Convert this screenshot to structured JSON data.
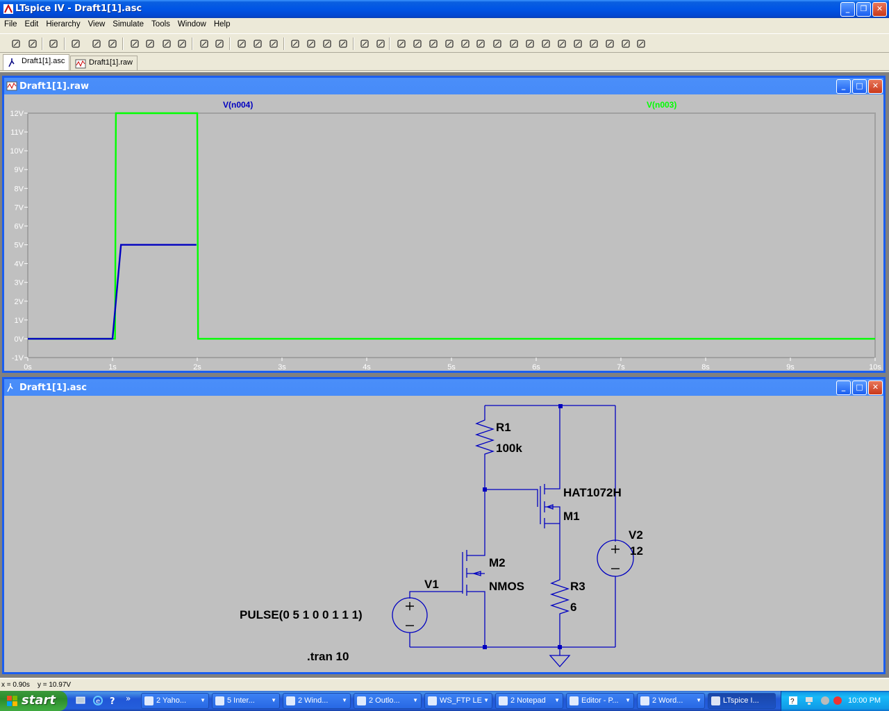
{
  "app": {
    "title": "LTspice IV - Draft1[1].asc"
  },
  "menu": [
    "File",
    "Edit",
    "Hierarchy",
    "View",
    "Simulate",
    "Tools",
    "Window",
    "Help"
  ],
  "toolbar_icons": [
    "new-schematic-icon",
    "open-icon",
    "save-icon",
    "control-panel-icon",
    "run-icon",
    "halt-icon",
    "zoom-in-icon",
    "zoom-pan-icon",
    "zoom-out-icon",
    "zoom-fit-icon",
    "autorange-icon",
    "reset-view-icon",
    "tile-horizontal-icon",
    "cascade-icon",
    "close-all-icon",
    "cut-icon",
    "copy-icon",
    "paste-icon",
    "find-icon",
    "print-setup-icon",
    "print-icon",
    "wire-icon",
    "ground-icon",
    "label-net-icon",
    "resistor-icon",
    "capacitor-icon",
    "inductor-icon",
    "diode-icon",
    "component-icon",
    "move-icon",
    "drag-icon",
    "undo-icon",
    "redo-icon",
    "rotate-icon",
    "mirror-icon",
    "text-icon",
    "spice-directive-icon"
  ],
  "tabs": [
    {
      "label": "Draft1[1].asc",
      "active": true
    },
    {
      "label": "Draft1[1].raw",
      "active": false
    }
  ],
  "waveform": {
    "title": "Draft1[1].raw",
    "trace_labels": [
      {
        "name": "V(n004)",
        "color": "#0000c0"
      },
      {
        "name": "V(n003)",
        "color": "#00ff00"
      }
    ]
  },
  "chart_data": {
    "type": "line",
    "x_ticks": [
      "0s",
      "1s",
      "2s",
      "3s",
      "4s",
      "5s",
      "6s",
      "7s",
      "8s",
      "9s",
      "10s"
    ],
    "y_ticks": [
      "12V",
      "11V",
      "10V",
      "9V",
      "8V",
      "7V",
      "6V",
      "5V",
      "4V",
      "3V",
      "2V",
      "1V",
      "0V",
      "-1V"
    ],
    "xlim": [
      0,
      10
    ],
    "ylim": [
      -1,
      12
    ],
    "series": [
      {
        "name": "V(n003)",
        "color": "#00ff00",
        "x": [
          0,
          1.03,
          1.04,
          2.0,
          2.01,
          10
        ],
        "y": [
          0,
          0,
          12,
          12,
          0,
          0
        ]
      },
      {
        "name": "V(n004)",
        "color": "#0000c0",
        "x": [
          0,
          1.0,
          1.1,
          1.98,
          1.99
        ],
        "y": [
          0,
          0,
          5,
          5,
          5
        ]
      }
    ]
  },
  "schematic": {
    "title": "Draft1[1].asc",
    "labels": {
      "r1_name": "R1",
      "r1_value": "100k",
      "m1_model": "HAT1072H",
      "m1_name": "M1",
      "m2_name": "M2",
      "m2_model": "NMOS",
      "v1_name": "V1",
      "v1_value": "PULSE(0 5 1 0 0 1 1 1)",
      "v2_name": "V2",
      "v2_value": "12",
      "r3_name": "R3",
      "r3_value": "6",
      "directive": ".tran 10"
    }
  },
  "status": {
    "text": "x = 0.90s    y = 10.97V"
  },
  "taskbar": {
    "start_label": "start",
    "tasks": [
      {
        "label": "2 Yaho...",
        "active": false
      },
      {
        "label": "5 Inter...",
        "active": false
      },
      {
        "label": "2 Wind...",
        "active": false
      },
      {
        "label": "2 Outlo...",
        "active": false
      },
      {
        "label": "WS_FTP LE",
        "active": false
      },
      {
        "label": "2 Notepad",
        "active": false
      },
      {
        "label": "Editor - P...",
        "active": false
      },
      {
        "label": "2 Word...",
        "active": false
      },
      {
        "label": "LTspice I...",
        "active": true
      }
    ],
    "clock": "10:00 PM"
  }
}
